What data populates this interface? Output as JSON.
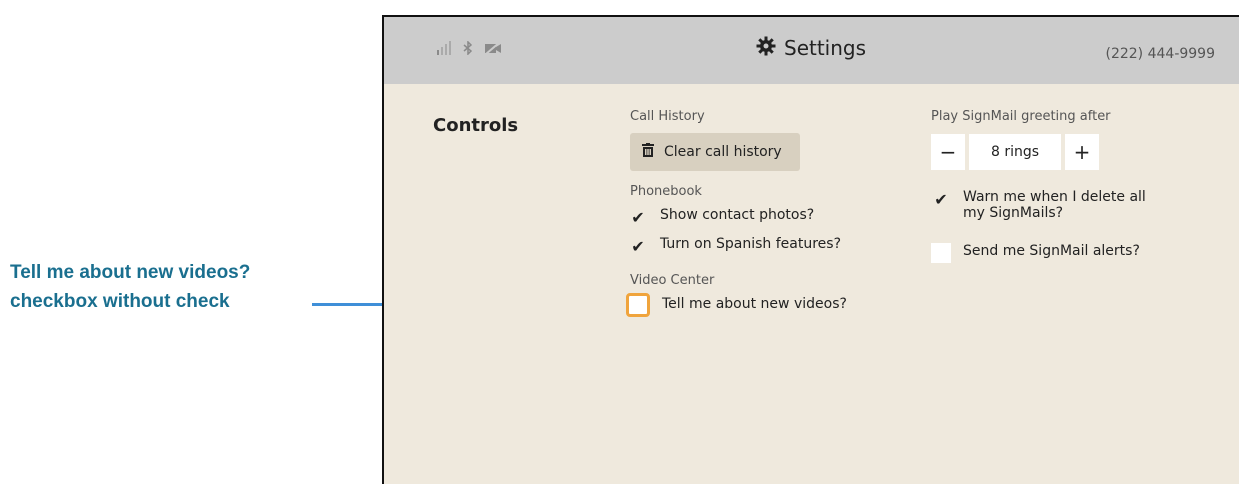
{
  "callout": {
    "line1": "Tell me about new videos?",
    "line2": "checkbox without check",
    "arrow_color": "#3f8fd8",
    "text_color": "#1a6f8f"
  },
  "header": {
    "title": "Settings",
    "phone": "(222) 444-9999",
    "icons": [
      "signal-icon",
      "bluetooth-icon",
      "camera-off-icon",
      "gear-icon"
    ]
  },
  "section": {
    "title": "Controls"
  },
  "call_history": {
    "label": "Call History",
    "clear_button": "Clear call history"
  },
  "phonebook": {
    "label": "Phonebook",
    "show_photos": {
      "label": "Show contact photos?",
      "checked": true
    },
    "spanish": {
      "label": "Turn on Spanish features?",
      "checked": true
    }
  },
  "video_center": {
    "label": "Video Center",
    "new_videos": {
      "label": "Tell me about new videos?",
      "checked": false
    }
  },
  "signmail": {
    "greeting_label": "Play SignMail greeting after",
    "minus": "−",
    "rings_value": "8 rings",
    "plus": "+",
    "warn_delete": {
      "label": "Warn me when I delete all my SignMails?",
      "checked": true
    },
    "alerts": {
      "label": "Send me SignMail alerts?",
      "checked": false
    }
  },
  "colors": {
    "background": "#efe9dd",
    "topbar": "#cccccc",
    "focus": "#f0a43c"
  }
}
